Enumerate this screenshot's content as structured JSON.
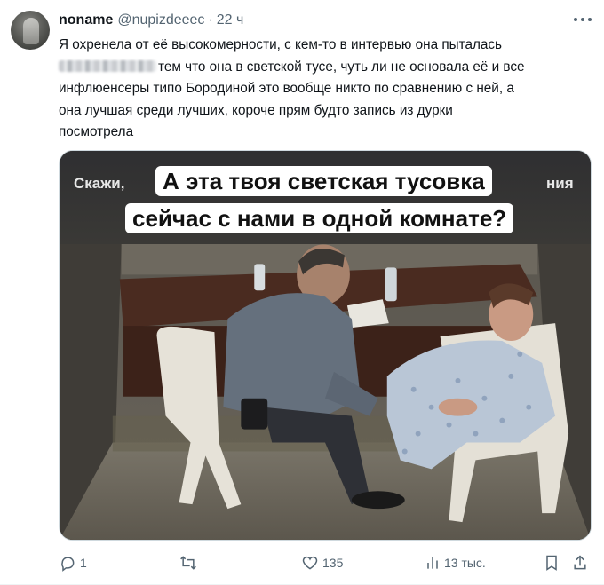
{
  "author": {
    "name": "noname",
    "handle": "@nupizdeeec",
    "separator": "·",
    "time": "22 ч"
  },
  "tweet_text": {
    "line1": "Я охренела от её высокомерности, с кем-то в интервью она пыталась",
    "line2_after_blur": "тем что она в светской тусе, чуть ли не основала её и все",
    "line3": "инфлюенсеры типо Бородиной это вообще никто по сравнению с ней, а",
    "line4": "она лучшая среди лучших, короче прям будто запись из дурки",
    "line5": "посмотрела"
  },
  "media": {
    "partial_caption_left": "Скажи,",
    "partial_caption_right": "ния",
    "caption_line1": "А эта твоя светская тусовка",
    "caption_line2": "сейчас с нами в одной комнате?"
  },
  "actions": {
    "reply_count": "1",
    "retweet_count": "",
    "like_count": "135",
    "views_count": "13 тыс."
  },
  "icons": {
    "more": "more-horizontal-icon",
    "reply": "reply-icon",
    "retweet": "retweet-icon",
    "like": "heart-icon",
    "views": "views-chart-icon",
    "bookmark": "bookmark-icon",
    "share": "share-icon"
  },
  "colors": {
    "text": "#0f1419",
    "secondary": "#536471",
    "border": "#cfd9de"
  }
}
